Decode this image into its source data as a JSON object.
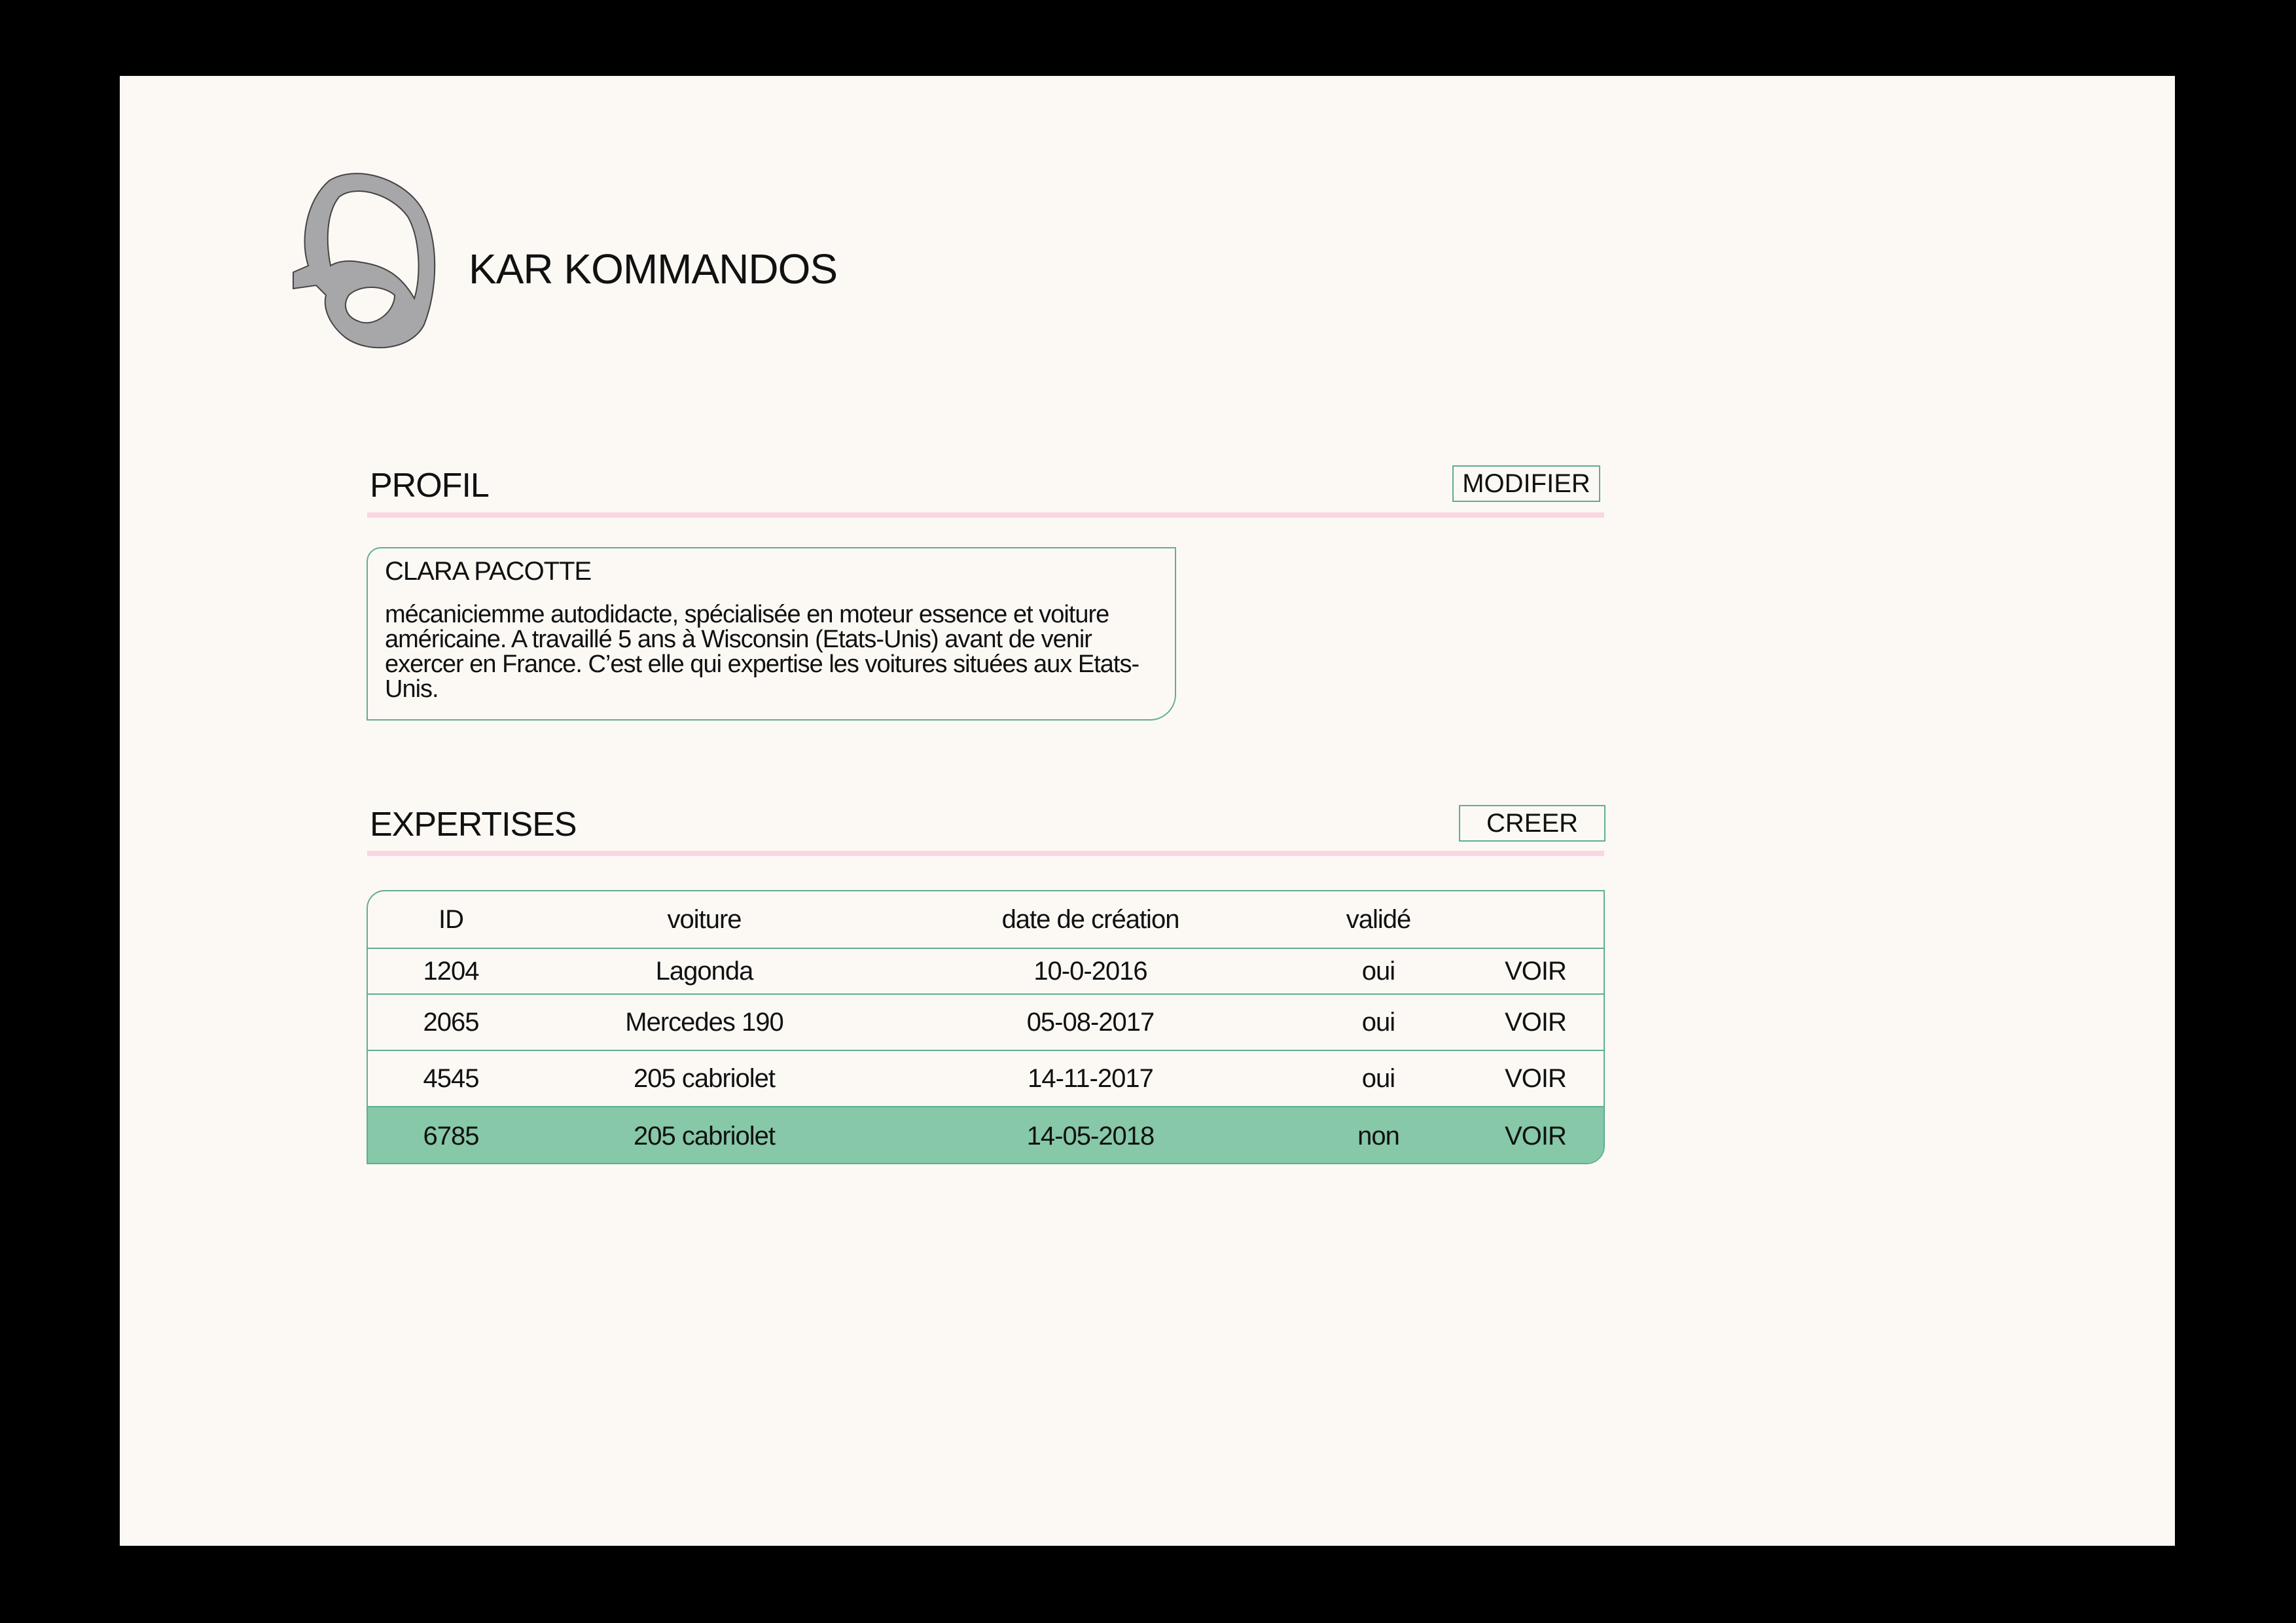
{
  "app": {
    "title": "KAR KOMMANDOS",
    "logo_icon": "steering-wheel-icon"
  },
  "profile": {
    "section_title": "PROFIL",
    "edit_button_label": "MODIFIER",
    "name": "CLARA PACOTTE",
    "bio": "mécaniciemme autodidacte, spécialisée en moteur essence et voiture américaine. A travaillé 5 ans à Wisconsin (Etats-Unis) avant de venir exercer en France. C’est elle qui expertise les voitures situées aux Etats-Unis."
  },
  "expertises": {
    "section_title": "EXPERTISES",
    "create_button_label": "CREER",
    "columns": [
      "ID",
      "voiture",
      "date de création",
      "validé",
      ""
    ],
    "rows": [
      {
        "id": "1204",
        "car": "Lagonda",
        "date": "10-0-2016",
        "validated": "oui",
        "action": "VOIR"
      },
      {
        "id": "2065",
        "car": "Mercedes 190",
        "date": "05-08-2017",
        "validated": "oui",
        "action": "VOIR"
      },
      {
        "id": "4545",
        "car": "205 cabriolet",
        "date": "14-11-2017",
        "validated": "oui",
        "action": "VOIR"
      },
      {
        "id": "6785",
        "car": "205 cabriolet",
        "date": "14-05-2018",
        "validated": "non",
        "action": "VOIR"
      }
    ]
  },
  "colors": {
    "page_background": "#fcf9f5",
    "frame": "#000000",
    "accent_border": "#5fae8f",
    "highlight_row": "#86c8a8",
    "section_rule": "#fad5e2",
    "logo_fill": "#a7a7aa"
  }
}
